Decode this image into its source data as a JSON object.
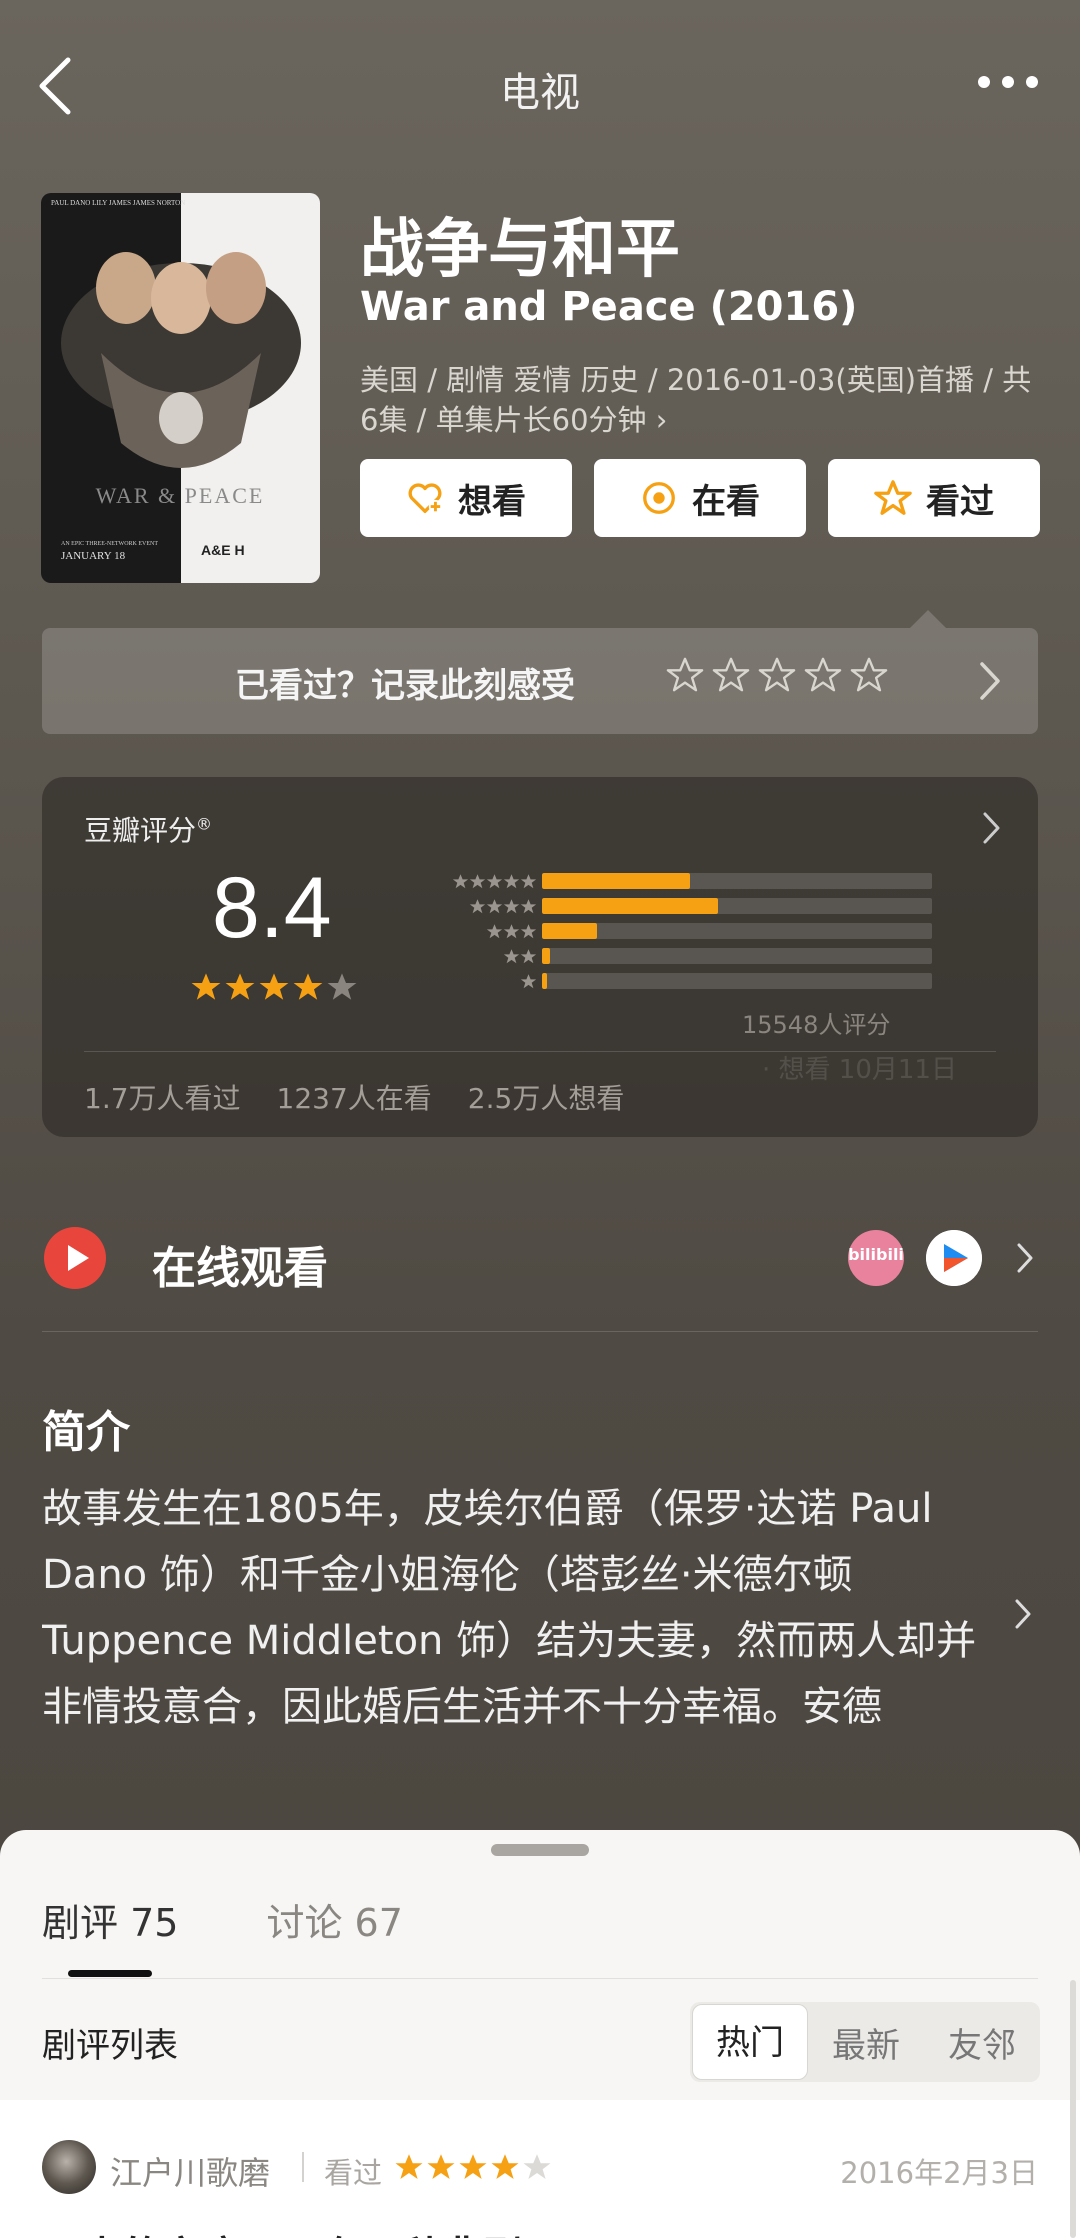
{
  "header": {
    "title": "电视"
  },
  "subject": {
    "title_cn": "战争与和平",
    "title_en": "War and Peace (2016)",
    "meta": "美国 / 剧情 爱情 历史 / 2016-01-03(英国)首播 / 共6集 / 单集片长60分钟 ›",
    "poster": {
      "top_names": "PAUL DANO   LILY JAMES   JAMES NORTON",
      "title": "WAR & PEACE",
      "tagline": "AN EPIC THREE-NETWORK EVENT",
      "date": "JANUARY 18",
      "networks": "A&E  H"
    }
  },
  "actions": {
    "want": "想看",
    "watching": "在看",
    "watched": "看过"
  },
  "record": {
    "prompt": "已看过？记录此刻感受"
  },
  "rating": {
    "label": "豆瓣评分",
    "label_mark": "®",
    "score": "8.4",
    "stars_value": 4.2,
    "distribution": [
      {
        "stars": 5,
        "fraction": 0.38
      },
      {
        "stars": 4,
        "fraction": 0.45
      },
      {
        "stars": 3,
        "fraction": 0.14
      },
      {
        "stars": 2,
        "fraction": 0.02
      },
      {
        "stars": 1,
        "fraction": 0.01
      }
    ],
    "count": "15548人评分",
    "stats": [
      "1.7万人看过",
      "1237人在看",
      "2.5万人想看"
    ],
    "ghost_note": "· 想看  10月11日"
  },
  "online": {
    "label": "在线观看",
    "bili_label": "bilibili"
  },
  "intro": {
    "title": "简介",
    "text": "故事发生在1805年，皮埃尔伯爵（保罗·达诺 Paul Dano 饰）和千金小姐海伦（塔彭丝·米德尔顿 Tuppence Middleton 饰）结为夫妻，然而两人却并非情投意合，因此婚后生活并不十分幸福。安德"
  },
  "sheet": {
    "tabs": [
      {
        "label": "剧评 75",
        "active": true
      },
      {
        "label": "讨论 67",
        "active": false
      }
    ],
    "list_label": "剧评列表",
    "sort_options": [
      {
        "label": "热门",
        "active": true
      },
      {
        "label": "最新",
        "active": false
      },
      {
        "label": "友邻",
        "active": false
      }
    ],
    "review": {
      "author": "江户川歌磨",
      "status": "看过",
      "stars": 4,
      "date": "2016年2月3日",
      "title": "不幸的家庭，只有一种悲剧"
    }
  },
  "colors": {
    "accent": "#f5a113",
    "play_red": "#e8453c"
  }
}
